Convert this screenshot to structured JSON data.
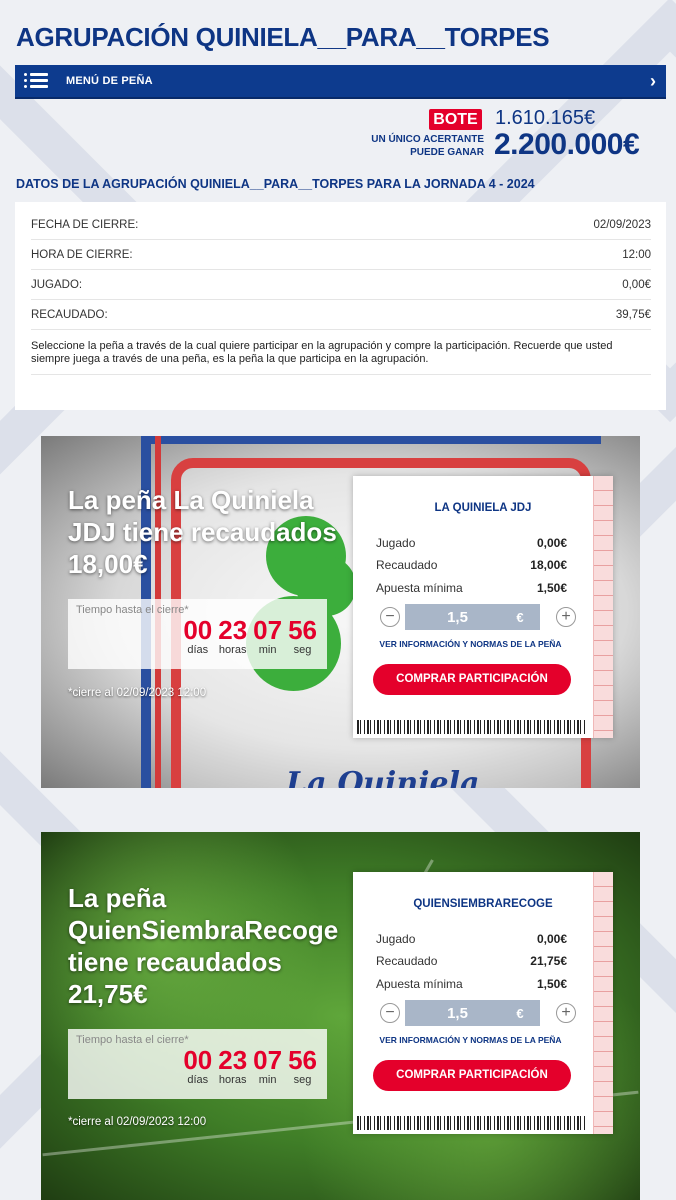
{
  "header": {
    "title": "AGRUPACIÓN QUINIELA__PARA__TORPES"
  },
  "menu": {
    "label": "MENÚ DE PEÑA"
  },
  "bote": {
    "tag": "BOTE",
    "amount": "1.610.165€",
    "acertante_line1": "UN ÚNICO ACERTANTE",
    "acertante_line2": "PUEDE GANAR",
    "prize": "2.200.000€"
  },
  "datos": {
    "title": "DATOS DE LA AGRUPACIÓN QUINIELA__PARA__TORPES PARA LA JORNADA 4 - 2024",
    "rows": [
      {
        "label": "FECHA DE CIERRE:",
        "value": "02/09/2023"
      },
      {
        "label": "HORA DE CIERRE:",
        "value": "12:00"
      },
      {
        "label": "JUGADO:",
        "value": "0,00€"
      },
      {
        "label": "RECAUDADO:",
        "value": "39,75€"
      }
    ],
    "note": "Seleccione la peña a través de la cual quiere participar en la agrupación y compre la participación. Recuerde que usted siempre juega a través de una peña, es la peña la que participa en la agrupación."
  },
  "penas": [
    {
      "headline": "La peña La Quiniela JDJ tiene recaudados 18,00€",
      "timer_label": "Tiempo hasta el cierre*",
      "dias": "00",
      "horas": "23",
      "min": "07",
      "seg": "56",
      "u_dias": "días",
      "u_horas": "horas",
      "u_min": "min",
      "u_seg": "seg",
      "cierre": "*cierre al 02/09/2023 12:00",
      "name": "LA QUINIELA JDJ",
      "jugado_label": "Jugado",
      "jugado": "0,00€",
      "recaudado_label": "Recaudado",
      "recaudado": "18,00€",
      "apuesta_label": "Apuesta mínima",
      "apuesta": "1,50€",
      "stepper_value": "1,5",
      "currency": "€",
      "info_link": "VER INFORMACIÓN Y NORMAS DE LA PEÑA",
      "buy": "COMPRAR PARTICIPACIÓN",
      "decor_logo": "La Quiniela"
    },
    {
      "headline": "La peña QuienSiembraRecoge tiene recaudados 21,75€",
      "timer_label": "Tiempo hasta el cierre*",
      "dias": "00",
      "horas": "23",
      "min": "07",
      "seg": "56",
      "u_dias": "días",
      "u_horas": "horas",
      "u_min": "min",
      "u_seg": "seg",
      "cierre": "*cierre al 02/09/2023 12:00",
      "name": "QUIENSIEMBRARECOGE",
      "jugado_label": "Jugado",
      "jugado": "0,00€",
      "recaudado_label": "Recaudado",
      "recaudado": "21,75€",
      "apuesta_label": "Apuesta mínima",
      "apuesta": "1,50€",
      "stepper_value": "1,5",
      "currency": "€",
      "info_link": "VER INFORMACIÓN Y NORMAS DE LA PEÑA",
      "buy": "COMPRAR PARTICIPACIÓN"
    }
  ],
  "icons": {
    "menu": "hamburger-icon",
    "chevron": "chevron-right-icon"
  },
  "colors": {
    "brand_blue": "#0e3584",
    "accent_red": "#e4002b"
  }
}
